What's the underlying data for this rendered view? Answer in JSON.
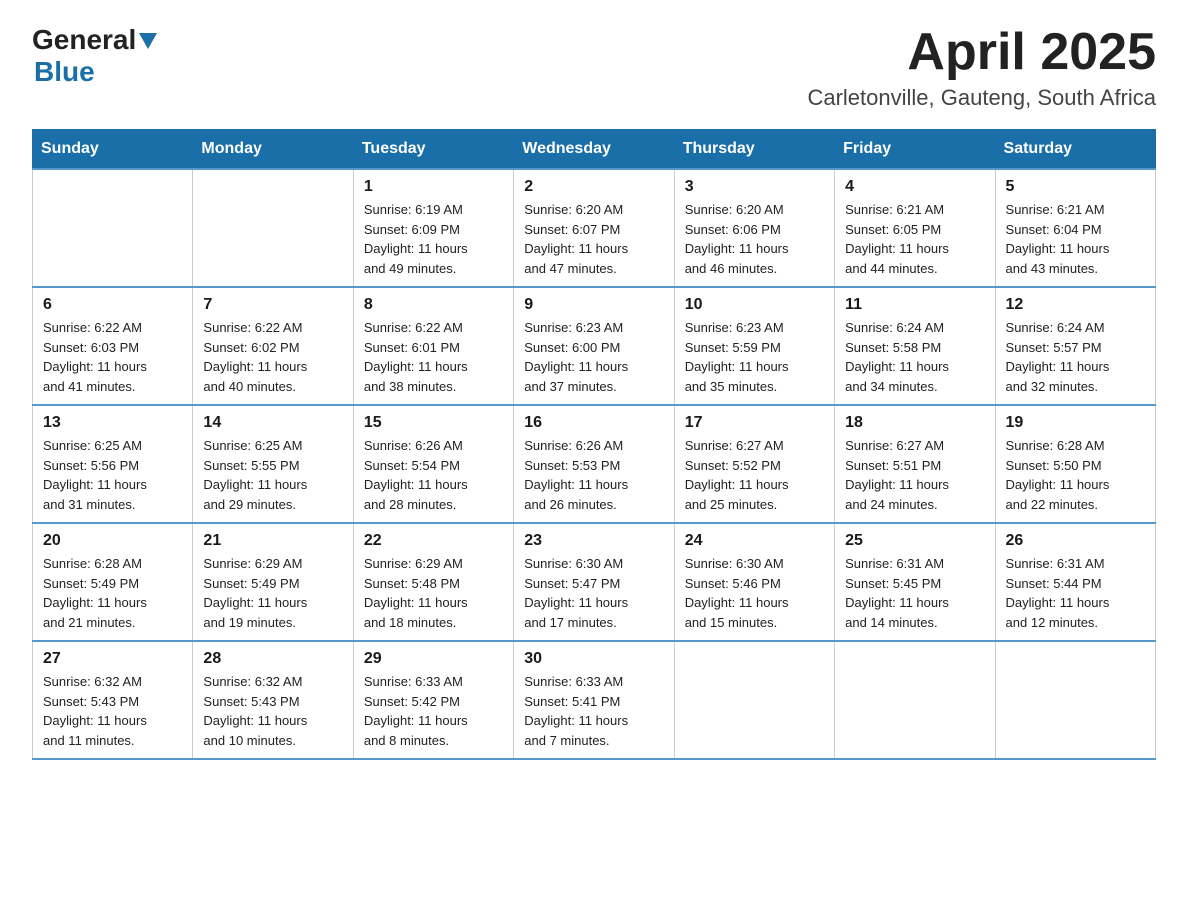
{
  "header": {
    "logo_general": "General",
    "logo_blue": "Blue",
    "month_title": "April 2025",
    "location": "Carletonville, Gauteng, South Africa"
  },
  "days_of_week": [
    "Sunday",
    "Monday",
    "Tuesday",
    "Wednesday",
    "Thursday",
    "Friday",
    "Saturday"
  ],
  "weeks": [
    [
      {
        "day": "",
        "info": ""
      },
      {
        "day": "",
        "info": ""
      },
      {
        "day": "1",
        "info": "Sunrise: 6:19 AM\nSunset: 6:09 PM\nDaylight: 11 hours\nand 49 minutes."
      },
      {
        "day": "2",
        "info": "Sunrise: 6:20 AM\nSunset: 6:07 PM\nDaylight: 11 hours\nand 47 minutes."
      },
      {
        "day": "3",
        "info": "Sunrise: 6:20 AM\nSunset: 6:06 PM\nDaylight: 11 hours\nand 46 minutes."
      },
      {
        "day": "4",
        "info": "Sunrise: 6:21 AM\nSunset: 6:05 PM\nDaylight: 11 hours\nand 44 minutes."
      },
      {
        "day": "5",
        "info": "Sunrise: 6:21 AM\nSunset: 6:04 PM\nDaylight: 11 hours\nand 43 minutes."
      }
    ],
    [
      {
        "day": "6",
        "info": "Sunrise: 6:22 AM\nSunset: 6:03 PM\nDaylight: 11 hours\nand 41 minutes."
      },
      {
        "day": "7",
        "info": "Sunrise: 6:22 AM\nSunset: 6:02 PM\nDaylight: 11 hours\nand 40 minutes."
      },
      {
        "day": "8",
        "info": "Sunrise: 6:22 AM\nSunset: 6:01 PM\nDaylight: 11 hours\nand 38 minutes."
      },
      {
        "day": "9",
        "info": "Sunrise: 6:23 AM\nSunset: 6:00 PM\nDaylight: 11 hours\nand 37 minutes."
      },
      {
        "day": "10",
        "info": "Sunrise: 6:23 AM\nSunset: 5:59 PM\nDaylight: 11 hours\nand 35 minutes."
      },
      {
        "day": "11",
        "info": "Sunrise: 6:24 AM\nSunset: 5:58 PM\nDaylight: 11 hours\nand 34 minutes."
      },
      {
        "day": "12",
        "info": "Sunrise: 6:24 AM\nSunset: 5:57 PM\nDaylight: 11 hours\nand 32 minutes."
      }
    ],
    [
      {
        "day": "13",
        "info": "Sunrise: 6:25 AM\nSunset: 5:56 PM\nDaylight: 11 hours\nand 31 minutes."
      },
      {
        "day": "14",
        "info": "Sunrise: 6:25 AM\nSunset: 5:55 PM\nDaylight: 11 hours\nand 29 minutes."
      },
      {
        "day": "15",
        "info": "Sunrise: 6:26 AM\nSunset: 5:54 PM\nDaylight: 11 hours\nand 28 minutes."
      },
      {
        "day": "16",
        "info": "Sunrise: 6:26 AM\nSunset: 5:53 PM\nDaylight: 11 hours\nand 26 minutes."
      },
      {
        "day": "17",
        "info": "Sunrise: 6:27 AM\nSunset: 5:52 PM\nDaylight: 11 hours\nand 25 minutes."
      },
      {
        "day": "18",
        "info": "Sunrise: 6:27 AM\nSunset: 5:51 PM\nDaylight: 11 hours\nand 24 minutes."
      },
      {
        "day": "19",
        "info": "Sunrise: 6:28 AM\nSunset: 5:50 PM\nDaylight: 11 hours\nand 22 minutes."
      }
    ],
    [
      {
        "day": "20",
        "info": "Sunrise: 6:28 AM\nSunset: 5:49 PM\nDaylight: 11 hours\nand 21 minutes."
      },
      {
        "day": "21",
        "info": "Sunrise: 6:29 AM\nSunset: 5:49 PM\nDaylight: 11 hours\nand 19 minutes."
      },
      {
        "day": "22",
        "info": "Sunrise: 6:29 AM\nSunset: 5:48 PM\nDaylight: 11 hours\nand 18 minutes."
      },
      {
        "day": "23",
        "info": "Sunrise: 6:30 AM\nSunset: 5:47 PM\nDaylight: 11 hours\nand 17 minutes."
      },
      {
        "day": "24",
        "info": "Sunrise: 6:30 AM\nSunset: 5:46 PM\nDaylight: 11 hours\nand 15 minutes."
      },
      {
        "day": "25",
        "info": "Sunrise: 6:31 AM\nSunset: 5:45 PM\nDaylight: 11 hours\nand 14 minutes."
      },
      {
        "day": "26",
        "info": "Sunrise: 6:31 AM\nSunset: 5:44 PM\nDaylight: 11 hours\nand 12 minutes."
      }
    ],
    [
      {
        "day": "27",
        "info": "Sunrise: 6:32 AM\nSunset: 5:43 PM\nDaylight: 11 hours\nand 11 minutes."
      },
      {
        "day": "28",
        "info": "Sunrise: 6:32 AM\nSunset: 5:43 PM\nDaylight: 11 hours\nand 10 minutes."
      },
      {
        "day": "29",
        "info": "Sunrise: 6:33 AM\nSunset: 5:42 PM\nDaylight: 11 hours\nand 8 minutes."
      },
      {
        "day": "30",
        "info": "Sunrise: 6:33 AM\nSunset: 5:41 PM\nDaylight: 11 hours\nand 7 minutes."
      },
      {
        "day": "",
        "info": ""
      },
      {
        "day": "",
        "info": ""
      },
      {
        "day": "",
        "info": ""
      }
    ]
  ]
}
